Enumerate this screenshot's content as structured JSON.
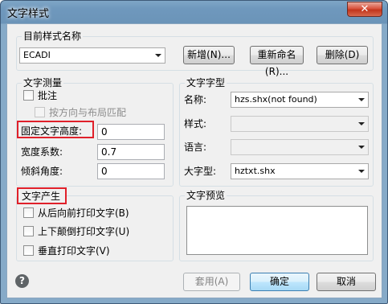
{
  "window": {
    "title": "文字样式",
    "close_glyph": "✕"
  },
  "current_style": {
    "group_label": "目前样式名称",
    "selected": "ECADI",
    "new_button": "新增(N)...",
    "rename_button": "重新命名(R)...",
    "delete_button": "删除(D)"
  },
  "text_measure": {
    "group_label": "文字测量",
    "annotative_label": "批注",
    "match_layout_label": "按方向与布局匹配",
    "fixed_height_label": "固定文字高度:",
    "fixed_height_value": "0",
    "width_factor_label": "宽度系数:",
    "width_factor_value": "0.7",
    "oblique_angle_label": "倾斜角度:",
    "oblique_angle_value": "0"
  },
  "text_font": {
    "group_label": "文字字型",
    "name_label": "名称:",
    "name_value": "hzs.shx(not found)",
    "style_label": "样式:",
    "style_value": "",
    "language_label": "语言:",
    "language_value": "",
    "bigfont_label": "大字型:",
    "bigfont_value": "hztxt.shx"
  },
  "text_generation": {
    "group_label": "文字产生",
    "backwards_label": "从后向前打印文字(B)",
    "upside_down_label": "上下颠倒打印文字(U)",
    "vertical_label": "垂直打印文字(V)"
  },
  "preview": {
    "group_label": "文字预览"
  },
  "footer": {
    "help_glyph": "?",
    "apply_button": "套用(A)",
    "ok_button": "确定",
    "cancel_button": "取消"
  },
  "colors": {
    "highlight_box": "#e0202a",
    "title_bar": "#7fa6c6"
  }
}
